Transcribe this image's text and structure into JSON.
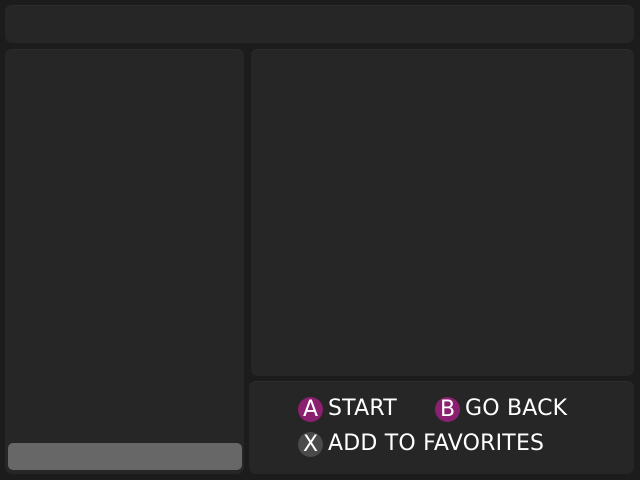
{
  "controls": {
    "a": {
      "key": "A",
      "label": "START",
      "color": "#8b2070"
    },
    "b": {
      "key": "B",
      "label": "GO BACK",
      "color": "#8b2070"
    },
    "x": {
      "key": "X",
      "label": "ADD TO FAVORITES",
      "color": "#4a4a4a"
    }
  }
}
